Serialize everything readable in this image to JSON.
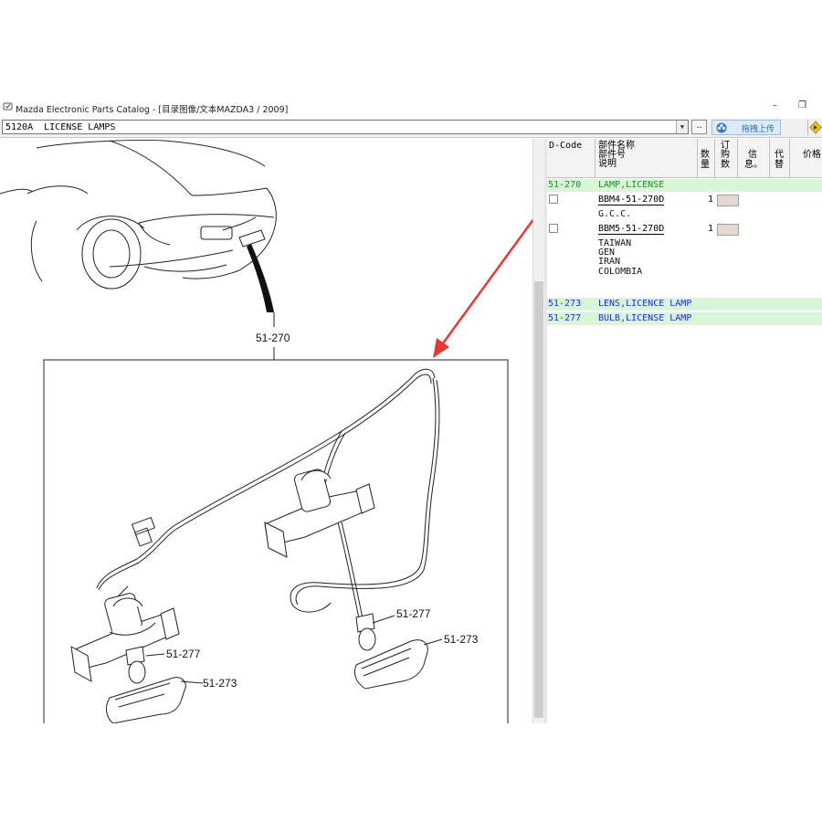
{
  "window": {
    "title": "Mazda Electronic Parts Catalog - [目录图像/文本MAZDA3 / 2009]",
    "min_symbol": "–",
    "max_symbol": "❐"
  },
  "toolbar": {
    "section_value": "5120A  LICENSE LAMPS",
    "dropdown_arrow": "▼",
    "dots_label": "..",
    "upload_label": "拖拽上传"
  },
  "grid": {
    "headers": {
      "dcode": "D-Code",
      "name_line1": "部件名称",
      "name_line2": "部件号",
      "name_line3": "说明",
      "qty_line1": "数",
      "qty_line2": "量",
      "order_line1": "订",
      "order_line2": "购",
      "order_line3": "数",
      "info_line1": "信",
      "info_line2": "息。",
      "replace_line1": "代",
      "replace_line2": "替",
      "price": "价格"
    },
    "rows": [
      {
        "code": "51-270",
        "name": "LAMP,LICENSE"
      },
      {
        "part_no": "BBM4-51-270D",
        "qty": "1",
        "notes": [
          "G.C.C."
        ]
      },
      {
        "part_no": "BBM5-51-270D",
        "qty": "1",
        "notes": [
          "TAIWAN",
          "GEN",
          "IRAN",
          "COLOMBIA"
        ]
      },
      {
        "code": "51-273",
        "name": "LENS,LICENCE LAMP"
      },
      {
        "code": "51-277",
        "name": "BULB,LICENSE LAMP"
      }
    ]
  },
  "diagram": {
    "labels": {
      "assembly": "51-270",
      "bulb_left": "51-277",
      "lens_left": "51-273",
      "bulb_right": "51-277",
      "lens_right": "51-273"
    },
    "arrow_color": "#e53935"
  }
}
